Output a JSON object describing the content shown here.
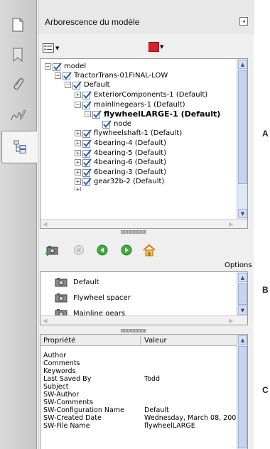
{
  "panel": {
    "title": "Arborescence du modèle",
    "collapse_icon": "collapse-arrow-icon",
    "accent_color": "#d8202f"
  },
  "left_nav": {
    "items": [
      {
        "icon": "pages-icon"
      },
      {
        "icon": "bookmark-icon"
      },
      {
        "icon": "attachment-icon"
      },
      {
        "icon": "signatures-icon"
      },
      {
        "icon": "model-tree-icon",
        "active": true
      }
    ]
  },
  "tree": {
    "rows": [
      {
        "label": "model",
        "expander": "−"
      },
      {
        "label": "TractorTrans-01FINAL-LOW",
        "expander": "−"
      },
      {
        "label": "Default",
        "expander": "−"
      },
      {
        "label": "ExteriorComponents-1 (Default)",
        "expander": "+"
      },
      {
        "label": "mainlinegears-1 (Default)",
        "expander": "−"
      },
      {
        "label": "flywheelLARGE-1 (Default)",
        "expander": "−",
        "bold": true
      },
      {
        "label": "node",
        "expander": ""
      },
      {
        "label": "flywheelshaft-1 (Default)",
        "expander": "+"
      },
      {
        "label": "4bearing-4 (Default)",
        "expander": "+"
      },
      {
        "label": "4bearing-5 (Default)",
        "expander": "+"
      },
      {
        "label": "4bearing-6 (Default)",
        "expander": "+"
      },
      {
        "label": "6bearing-3 (Default)",
        "expander": "+"
      },
      {
        "label": "gear32b-2 (Default)",
        "expander": "+"
      }
    ]
  },
  "views_toolbar": {
    "options_label": "Options"
  },
  "views": {
    "items": [
      {
        "label": "Default"
      },
      {
        "label": "Flywheel spacer"
      },
      {
        "label": "Mainline gears"
      }
    ]
  },
  "properties": {
    "col_property": "Propriété",
    "col_value": "Valeur",
    "rows": [
      {
        "name": "Author",
        "value": ""
      },
      {
        "name": "Comments",
        "value": ""
      },
      {
        "name": "Keywords",
        "value": ""
      },
      {
        "name": "Last Saved By",
        "value": "Todd"
      },
      {
        "name": "Subject",
        "value": ""
      },
      {
        "name": "SW-Author",
        "value": ""
      },
      {
        "name": "SW-Comments",
        "value": ""
      },
      {
        "name": "SW-Configuration Name",
        "value": "Default"
      },
      {
        "name": "SW-Created Date",
        "value": "Wednesday, March 08, 200"
      },
      {
        "name": "SW-File Name",
        "value": "flywheelLARGE"
      }
    ]
  },
  "section_labels": {
    "a": "A",
    "b": "B",
    "c": "C"
  }
}
